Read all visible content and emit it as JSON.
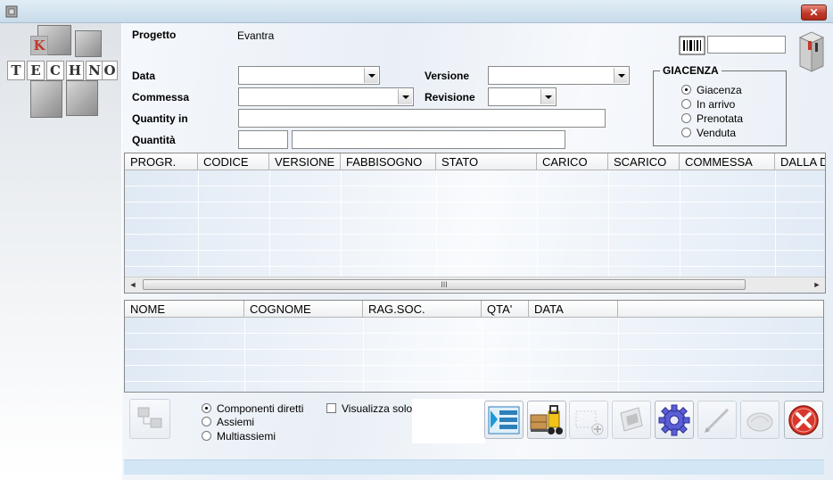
{
  "form": {
    "progetto_label": "Progetto",
    "progetto_value": "Evantra",
    "data_label": "Data",
    "commessa_label": "Commessa",
    "quantity_in_label": "Quantity in",
    "quantita_label": "Quantità",
    "versione_label": "Versione",
    "revisione_label": "Revisione"
  },
  "giacenza": {
    "title": "GIACENZA",
    "options": [
      {
        "label": "Giacenza",
        "selected": true
      },
      {
        "label": "In arrivo",
        "selected": false
      },
      {
        "label": "Prenotata",
        "selected": false
      },
      {
        "label": "Venduta",
        "selected": false
      }
    ]
  },
  "logo": {
    "top_letter": "K",
    "letters": [
      "T",
      "E",
      "C",
      "H",
      "N",
      "O"
    ]
  },
  "grid_main": {
    "columns": [
      "PROGR.",
      "CODICE",
      "VERSIONE",
      "FABBISOGNO",
      "STATO",
      "CARICO",
      "SCARICO",
      "COMMESSA",
      "DALLA D"
    ],
    "scroll_grip": "III"
  },
  "grid_people": {
    "columns": [
      "NOME",
      "COGNOME",
      "RAG.SOC.",
      "QTA'",
      "DATA"
    ]
  },
  "bottom": {
    "radio_options": [
      {
        "label": "Componenti diretti",
        "selected": true
      },
      {
        "label": "Assiemi",
        "selected": false
      },
      {
        "label": "Multiassiemi",
        "selected": false
      }
    ],
    "checkbox_label": "Visualizza solo"
  },
  "toolbar_buttons": [
    {
      "name": "list-view-button",
      "icon": "list-icon",
      "enabled": true
    },
    {
      "name": "forklift-button",
      "icon": "forklift-icon",
      "enabled": true
    },
    {
      "name": "add-button",
      "icon": "add-icon",
      "enabled": false
    },
    {
      "name": "print-button",
      "icon": "print-icon",
      "enabled": false
    },
    {
      "name": "settings-button",
      "icon": "gear-icon",
      "enabled": true
    },
    {
      "name": "edit-button",
      "icon": "pen-icon",
      "enabled": false
    },
    {
      "name": "erase-button",
      "icon": "eraser-icon",
      "enabled": false
    },
    {
      "name": "close-form-button",
      "icon": "close-icon",
      "enabled": true
    }
  ],
  "colors": {
    "accent_red": "#c0392b",
    "status_bar": "#d2e6f5",
    "gear_blue": "#5b5fd6"
  }
}
